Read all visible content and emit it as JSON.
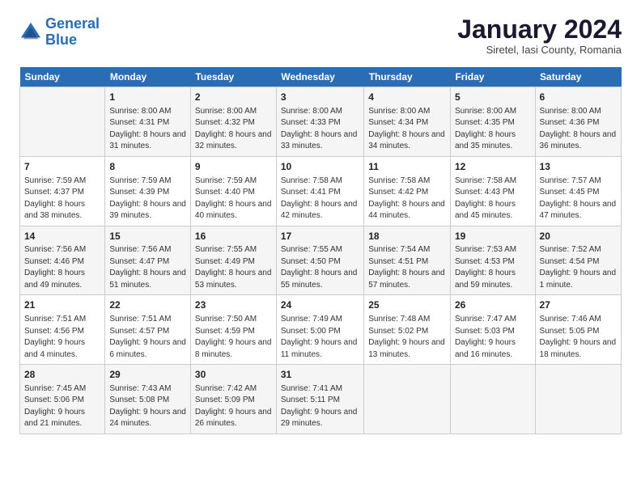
{
  "header": {
    "logo_line1": "General",
    "logo_line2": "Blue",
    "title": "January 2024",
    "subtitle": "Siretel, Iasi County, Romania"
  },
  "weekdays": [
    "Sunday",
    "Monday",
    "Tuesday",
    "Wednesday",
    "Thursday",
    "Friday",
    "Saturday"
  ],
  "weeks": [
    [
      {
        "day": "",
        "info": ""
      },
      {
        "day": "1",
        "info": "Sunrise: 8:00 AM\nSunset: 4:31 PM\nDaylight: 8 hours\nand 31 minutes."
      },
      {
        "day": "2",
        "info": "Sunrise: 8:00 AM\nSunset: 4:32 PM\nDaylight: 8 hours\nand 32 minutes."
      },
      {
        "day": "3",
        "info": "Sunrise: 8:00 AM\nSunset: 4:33 PM\nDaylight: 8 hours\nand 33 minutes."
      },
      {
        "day": "4",
        "info": "Sunrise: 8:00 AM\nSunset: 4:34 PM\nDaylight: 8 hours\nand 34 minutes."
      },
      {
        "day": "5",
        "info": "Sunrise: 8:00 AM\nSunset: 4:35 PM\nDaylight: 8 hours\nand 35 minutes."
      },
      {
        "day": "6",
        "info": "Sunrise: 8:00 AM\nSunset: 4:36 PM\nDaylight: 8 hours\nand 36 minutes."
      }
    ],
    [
      {
        "day": "7",
        "info": "Sunrise: 7:59 AM\nSunset: 4:37 PM\nDaylight: 8 hours\nand 38 minutes."
      },
      {
        "day": "8",
        "info": "Sunrise: 7:59 AM\nSunset: 4:39 PM\nDaylight: 8 hours\nand 39 minutes."
      },
      {
        "day": "9",
        "info": "Sunrise: 7:59 AM\nSunset: 4:40 PM\nDaylight: 8 hours\nand 40 minutes."
      },
      {
        "day": "10",
        "info": "Sunrise: 7:58 AM\nSunset: 4:41 PM\nDaylight: 8 hours\nand 42 minutes."
      },
      {
        "day": "11",
        "info": "Sunrise: 7:58 AM\nSunset: 4:42 PM\nDaylight: 8 hours\nand 44 minutes."
      },
      {
        "day": "12",
        "info": "Sunrise: 7:58 AM\nSunset: 4:43 PM\nDaylight: 8 hours\nand 45 minutes."
      },
      {
        "day": "13",
        "info": "Sunrise: 7:57 AM\nSunset: 4:45 PM\nDaylight: 8 hours\nand 47 minutes."
      }
    ],
    [
      {
        "day": "14",
        "info": "Sunrise: 7:56 AM\nSunset: 4:46 PM\nDaylight: 8 hours\nand 49 minutes."
      },
      {
        "day": "15",
        "info": "Sunrise: 7:56 AM\nSunset: 4:47 PM\nDaylight: 8 hours\nand 51 minutes."
      },
      {
        "day": "16",
        "info": "Sunrise: 7:55 AM\nSunset: 4:49 PM\nDaylight: 8 hours\nand 53 minutes."
      },
      {
        "day": "17",
        "info": "Sunrise: 7:55 AM\nSunset: 4:50 PM\nDaylight: 8 hours\nand 55 minutes."
      },
      {
        "day": "18",
        "info": "Sunrise: 7:54 AM\nSunset: 4:51 PM\nDaylight: 8 hours\nand 57 minutes."
      },
      {
        "day": "19",
        "info": "Sunrise: 7:53 AM\nSunset: 4:53 PM\nDaylight: 8 hours\nand 59 minutes."
      },
      {
        "day": "20",
        "info": "Sunrise: 7:52 AM\nSunset: 4:54 PM\nDaylight: 9 hours\nand 1 minute."
      }
    ],
    [
      {
        "day": "21",
        "info": "Sunrise: 7:51 AM\nSunset: 4:56 PM\nDaylight: 9 hours\nand 4 minutes."
      },
      {
        "day": "22",
        "info": "Sunrise: 7:51 AM\nSunset: 4:57 PM\nDaylight: 9 hours\nand 6 minutes."
      },
      {
        "day": "23",
        "info": "Sunrise: 7:50 AM\nSunset: 4:59 PM\nDaylight: 9 hours\nand 8 minutes."
      },
      {
        "day": "24",
        "info": "Sunrise: 7:49 AM\nSunset: 5:00 PM\nDaylight: 9 hours\nand 11 minutes."
      },
      {
        "day": "25",
        "info": "Sunrise: 7:48 AM\nSunset: 5:02 PM\nDaylight: 9 hours\nand 13 minutes."
      },
      {
        "day": "26",
        "info": "Sunrise: 7:47 AM\nSunset: 5:03 PM\nDaylight: 9 hours\nand 16 minutes."
      },
      {
        "day": "27",
        "info": "Sunrise: 7:46 AM\nSunset: 5:05 PM\nDaylight: 9 hours\nand 18 minutes."
      }
    ],
    [
      {
        "day": "28",
        "info": "Sunrise: 7:45 AM\nSunset: 5:06 PM\nDaylight: 9 hours\nand 21 minutes."
      },
      {
        "day": "29",
        "info": "Sunrise: 7:43 AM\nSunset: 5:08 PM\nDaylight: 9 hours\nand 24 minutes."
      },
      {
        "day": "30",
        "info": "Sunrise: 7:42 AM\nSunset: 5:09 PM\nDaylight: 9 hours\nand 26 minutes."
      },
      {
        "day": "31",
        "info": "Sunrise: 7:41 AM\nSunset: 5:11 PM\nDaylight: 9 hours\nand 29 minutes."
      },
      {
        "day": "",
        "info": ""
      },
      {
        "day": "",
        "info": ""
      },
      {
        "day": "",
        "info": ""
      }
    ]
  ]
}
